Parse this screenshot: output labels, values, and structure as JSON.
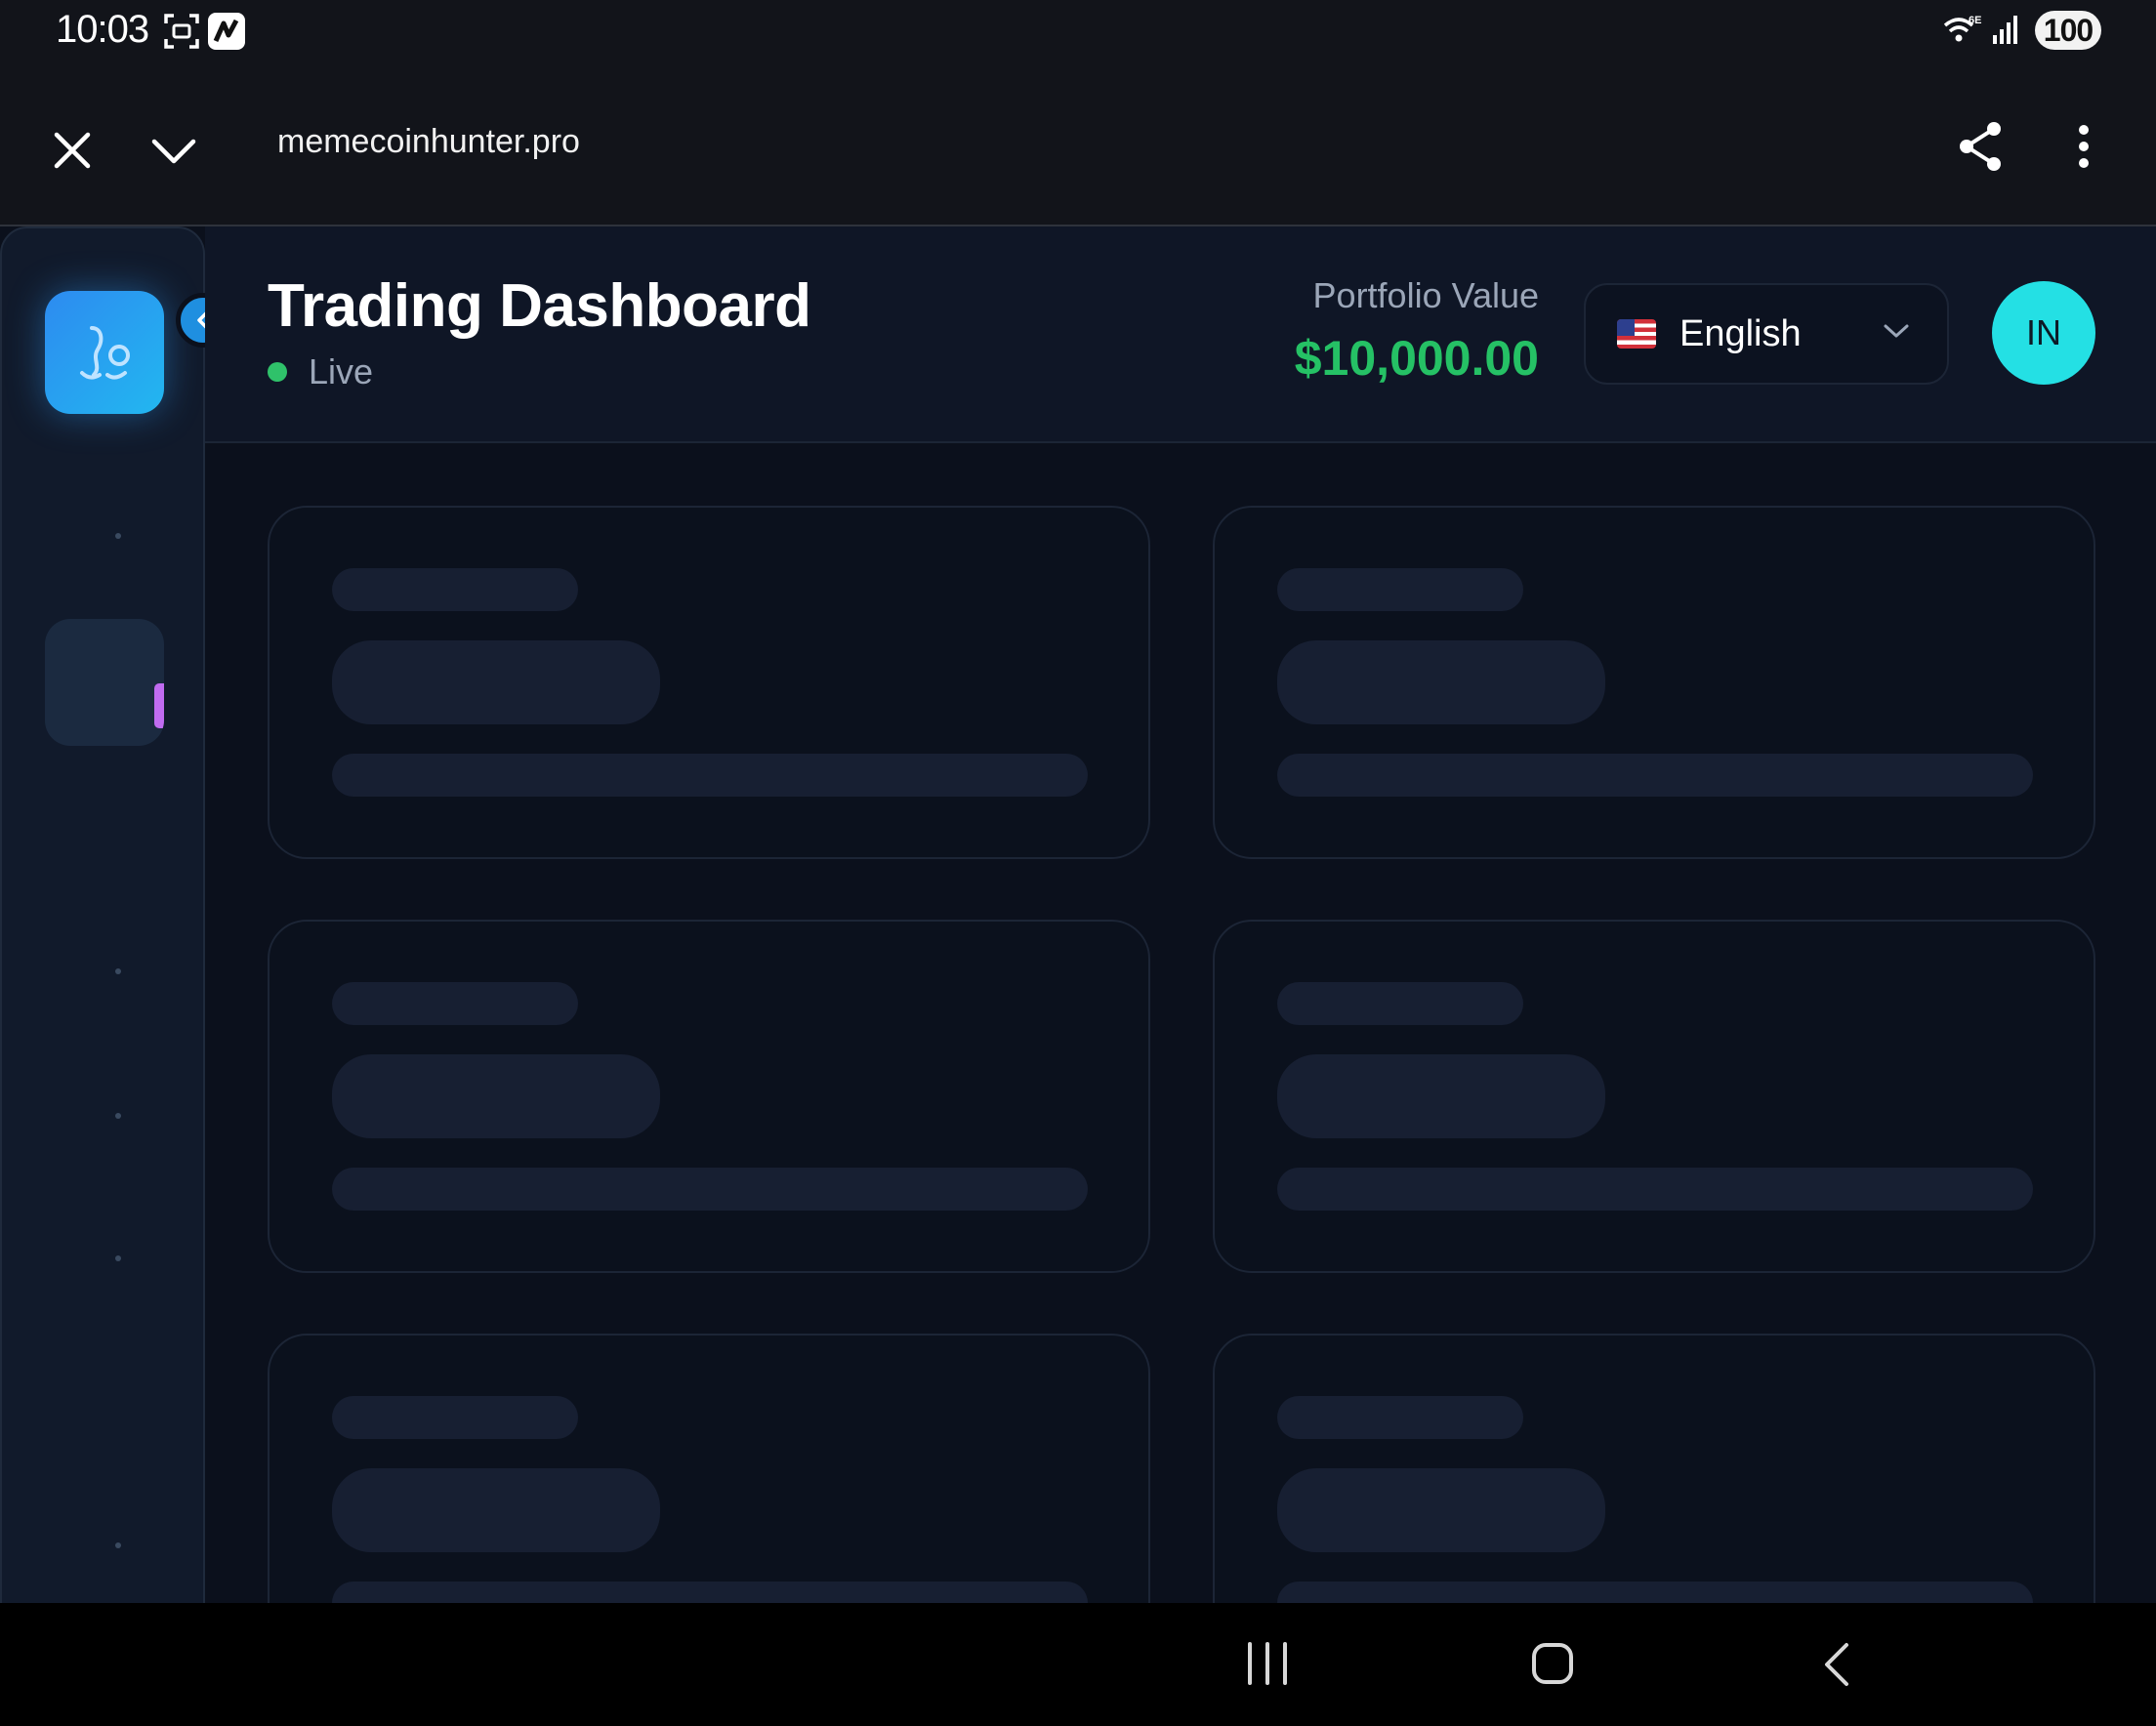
{
  "status_bar": {
    "time": "10:03",
    "battery": "100",
    "network": "6E"
  },
  "browser": {
    "url": "memecoinhunter.pro"
  },
  "header": {
    "title": "Trading Dashboard",
    "status": "Live",
    "portfolio_label": "Portfolio Value",
    "portfolio_value": "$10,000.00",
    "language": "English",
    "avatar_initials": "IN"
  },
  "colors": {
    "accent": "#1f8fe0",
    "live": "#2fc26a",
    "portfolio_value": "#25c165",
    "avatar": "#24e0e4",
    "nav_active_indicator": "#c06bf0"
  }
}
